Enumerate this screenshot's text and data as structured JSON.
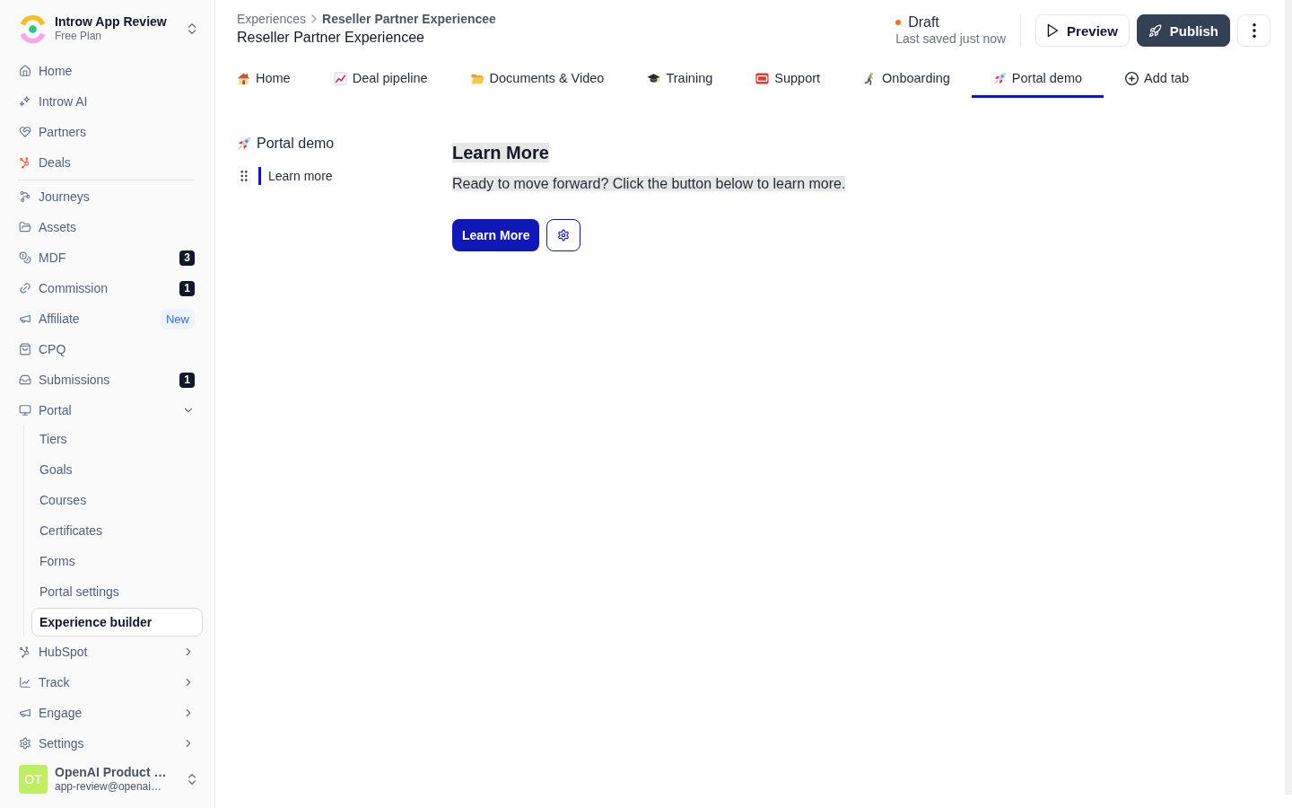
{
  "workspace": {
    "name": "Introw App Review",
    "plan": "Free Plan"
  },
  "sidebar": {
    "groups": [
      {
        "items": [
          {
            "label": "Home",
            "selected": false
          },
          {
            "label": "Introw AI",
            "selected": false
          },
          {
            "label": "Partners",
            "selected": false
          },
          {
            "label": "Deals",
            "selected": false
          }
        ]
      },
      {
        "items": [
          {
            "label": "Journeys",
            "selected": false
          },
          {
            "label": "Assets",
            "selected": false
          },
          {
            "label": "MDF",
            "selected": false,
            "badge": {
              "kind": "count",
              "text": "3"
            }
          },
          {
            "label": "Commission",
            "selected": false,
            "badge": {
              "kind": "count",
              "text": "1"
            }
          },
          {
            "label": "Affiliate",
            "selected": false,
            "badge": {
              "kind": "tag",
              "text": "New"
            }
          },
          {
            "label": "CPQ",
            "selected": false
          },
          {
            "label": "Submissions",
            "selected": false,
            "badge": {
              "kind": "count",
              "text": "1"
            }
          },
          {
            "label": "Portal",
            "selected": false,
            "expanded": true,
            "children": [
              {
                "label": "Tiers",
                "selected": false
              },
              {
                "label": "Goals",
                "selected": false
              },
              {
                "label": "Courses",
                "selected": false
              },
              {
                "label": "Certificates",
                "selected": false
              },
              {
                "label": "Forms",
                "selected": false
              },
              {
                "label": "Portal settings",
                "selected": false
              },
              {
                "label": "Experience builder",
                "selected": true
              }
            ]
          },
          {
            "label": "HubSpot",
            "selected": false,
            "expanded": false
          },
          {
            "label": "Track",
            "selected": false,
            "expanded": false
          },
          {
            "label": "Engage",
            "selected": false,
            "expanded": false
          },
          {
            "label": "Settings",
            "selected": false,
            "expanded": false
          }
        ]
      }
    ]
  },
  "user": {
    "initials": "OT",
    "name": "OpenAI Product …",
    "email": "app-review@openai…"
  },
  "breadcrumb": [
    {
      "label": "Experiences"
    },
    {
      "label": "Reseller Partner Experiencee"
    }
  ],
  "title": "Reseller Partner Experiencee",
  "status": {
    "label": "Draft",
    "saved": "Last saved just now"
  },
  "actions": [
    {
      "kind": "secondary",
      "label": "Preview"
    },
    {
      "kind": "primary",
      "label": "Publish"
    },
    {
      "kind": "more"
    }
  ],
  "tabs": [
    {
      "label": "Home",
      "selected": false
    },
    {
      "label": "Deal pipeline",
      "selected": false
    },
    {
      "label": "Documents & Video",
      "selected": false
    },
    {
      "label": "Training",
      "selected": false
    },
    {
      "label": "Support",
      "selected": false
    },
    {
      "label": "Onboarding",
      "selected": false
    },
    {
      "label": "Portal demo",
      "selected": true
    }
  ],
  "add_tab": {
    "label": "Add tab"
  },
  "page_tree": {
    "title": "Portal demo",
    "items": [
      {
        "label": "Learn more",
        "selected": true
      }
    ]
  },
  "block": {
    "heading": "Learn More",
    "text": "Ready to move forward? Click the button below to learn more.",
    "button": "Learn More"
  }
}
